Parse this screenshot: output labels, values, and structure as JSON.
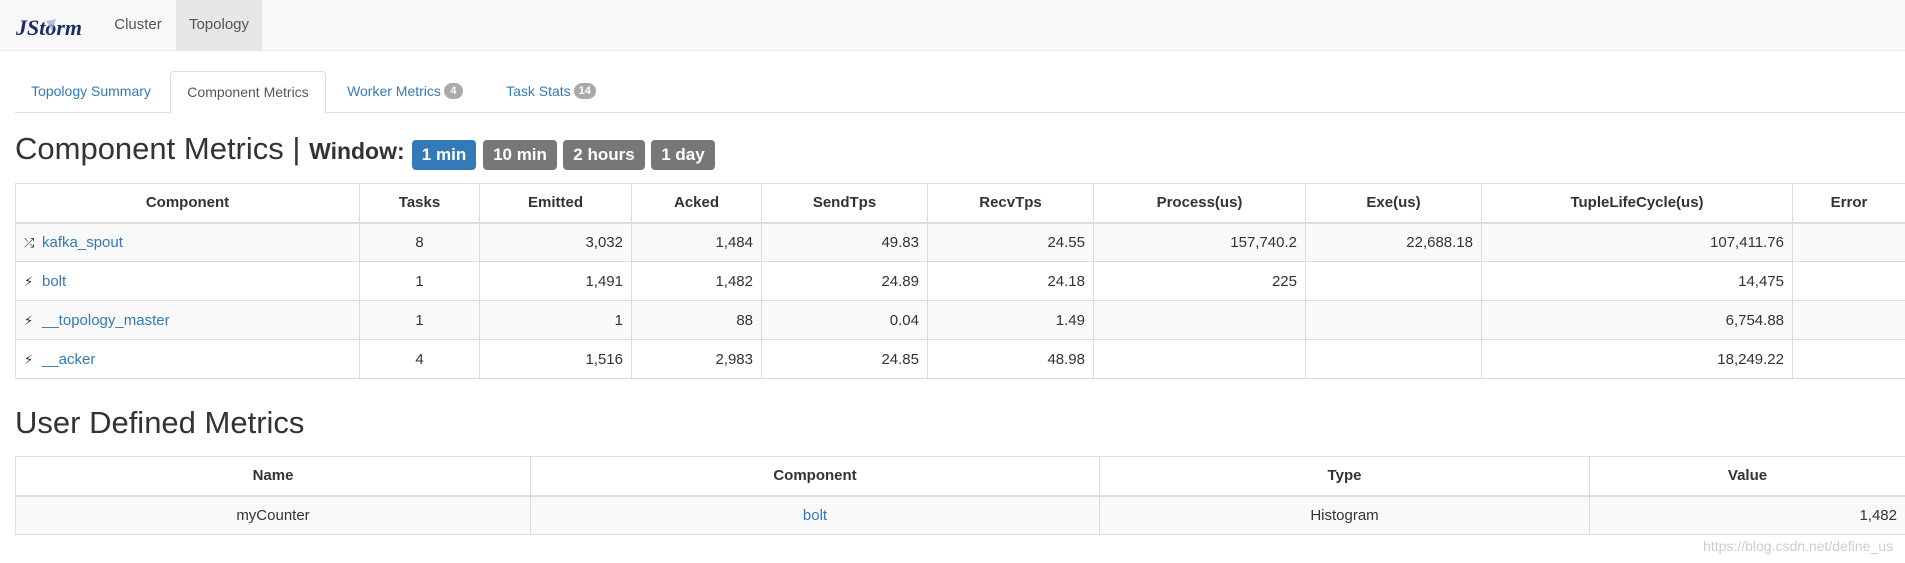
{
  "navbar": {
    "brand": "JStorm",
    "items": [
      {
        "label": "Cluster",
        "active": false
      },
      {
        "label": "Topology",
        "active": true
      }
    ]
  },
  "tabs": [
    {
      "label": "Topology Summary",
      "active": false,
      "badge": ""
    },
    {
      "label": "Component Metrics",
      "active": true,
      "badge": ""
    },
    {
      "label": "Worker Metrics",
      "active": false,
      "badge": "4"
    },
    {
      "label": "Task Stats",
      "active": false,
      "badge": "14"
    }
  ],
  "heading": {
    "title": "Component Metrics |",
    "window_label": "Window:",
    "windows": [
      {
        "label": "1 min",
        "active": true
      },
      {
        "label": "10 min",
        "active": false
      },
      {
        "label": "2 hours",
        "active": false
      },
      {
        "label": "1 day",
        "active": false
      }
    ]
  },
  "component_table": {
    "headers": [
      "Component",
      "Tasks",
      "Emitted",
      "Acked",
      "SendTps",
      "RecvTps",
      "Process(us)",
      "Exe(us)",
      "TupleLifeCycle(us)",
      "Error"
    ],
    "rows": [
      {
        "icon": "shuffle-icon",
        "glyph": "⤮",
        "name": "kafka_spout",
        "tasks": "8",
        "emitted": "3,032",
        "acked": "1,484",
        "sendtps": "49.83",
        "recvtps": "24.55",
        "process": "157,740.2",
        "exe": "22,688.18",
        "tuple": "107,411.76",
        "error": ""
      },
      {
        "icon": "bolt-icon",
        "glyph": "⚡",
        "name": "bolt",
        "tasks": "1",
        "emitted": "1,491",
        "acked": "1,482",
        "sendtps": "24.89",
        "recvtps": "24.18",
        "process": "225",
        "exe": "",
        "tuple": "14,475",
        "error": ""
      },
      {
        "icon": "bolt-icon",
        "glyph": "⚡",
        "name": "__topology_master",
        "tasks": "1",
        "emitted": "1",
        "acked": "88",
        "sendtps": "0.04",
        "recvtps": "1.49",
        "process": "",
        "exe": "",
        "tuple": "6,754.88",
        "error": ""
      },
      {
        "icon": "bolt-icon",
        "glyph": "⚡",
        "name": "__acker",
        "tasks": "4",
        "emitted": "1,516",
        "acked": "2,983",
        "sendtps": "24.85",
        "recvtps": "48.98",
        "process": "",
        "exe": "",
        "tuple": "18,249.22",
        "error": ""
      }
    ]
  },
  "user_metrics": {
    "title": "User Defined Metrics",
    "headers": [
      "Name",
      "Component",
      "Type",
      "Value"
    ],
    "rows": [
      {
        "name": "myCounter",
        "component": "bolt",
        "type": "Histogram",
        "value": "1,482"
      }
    ]
  },
  "watermark": "https://blog.csdn.net/define_us"
}
